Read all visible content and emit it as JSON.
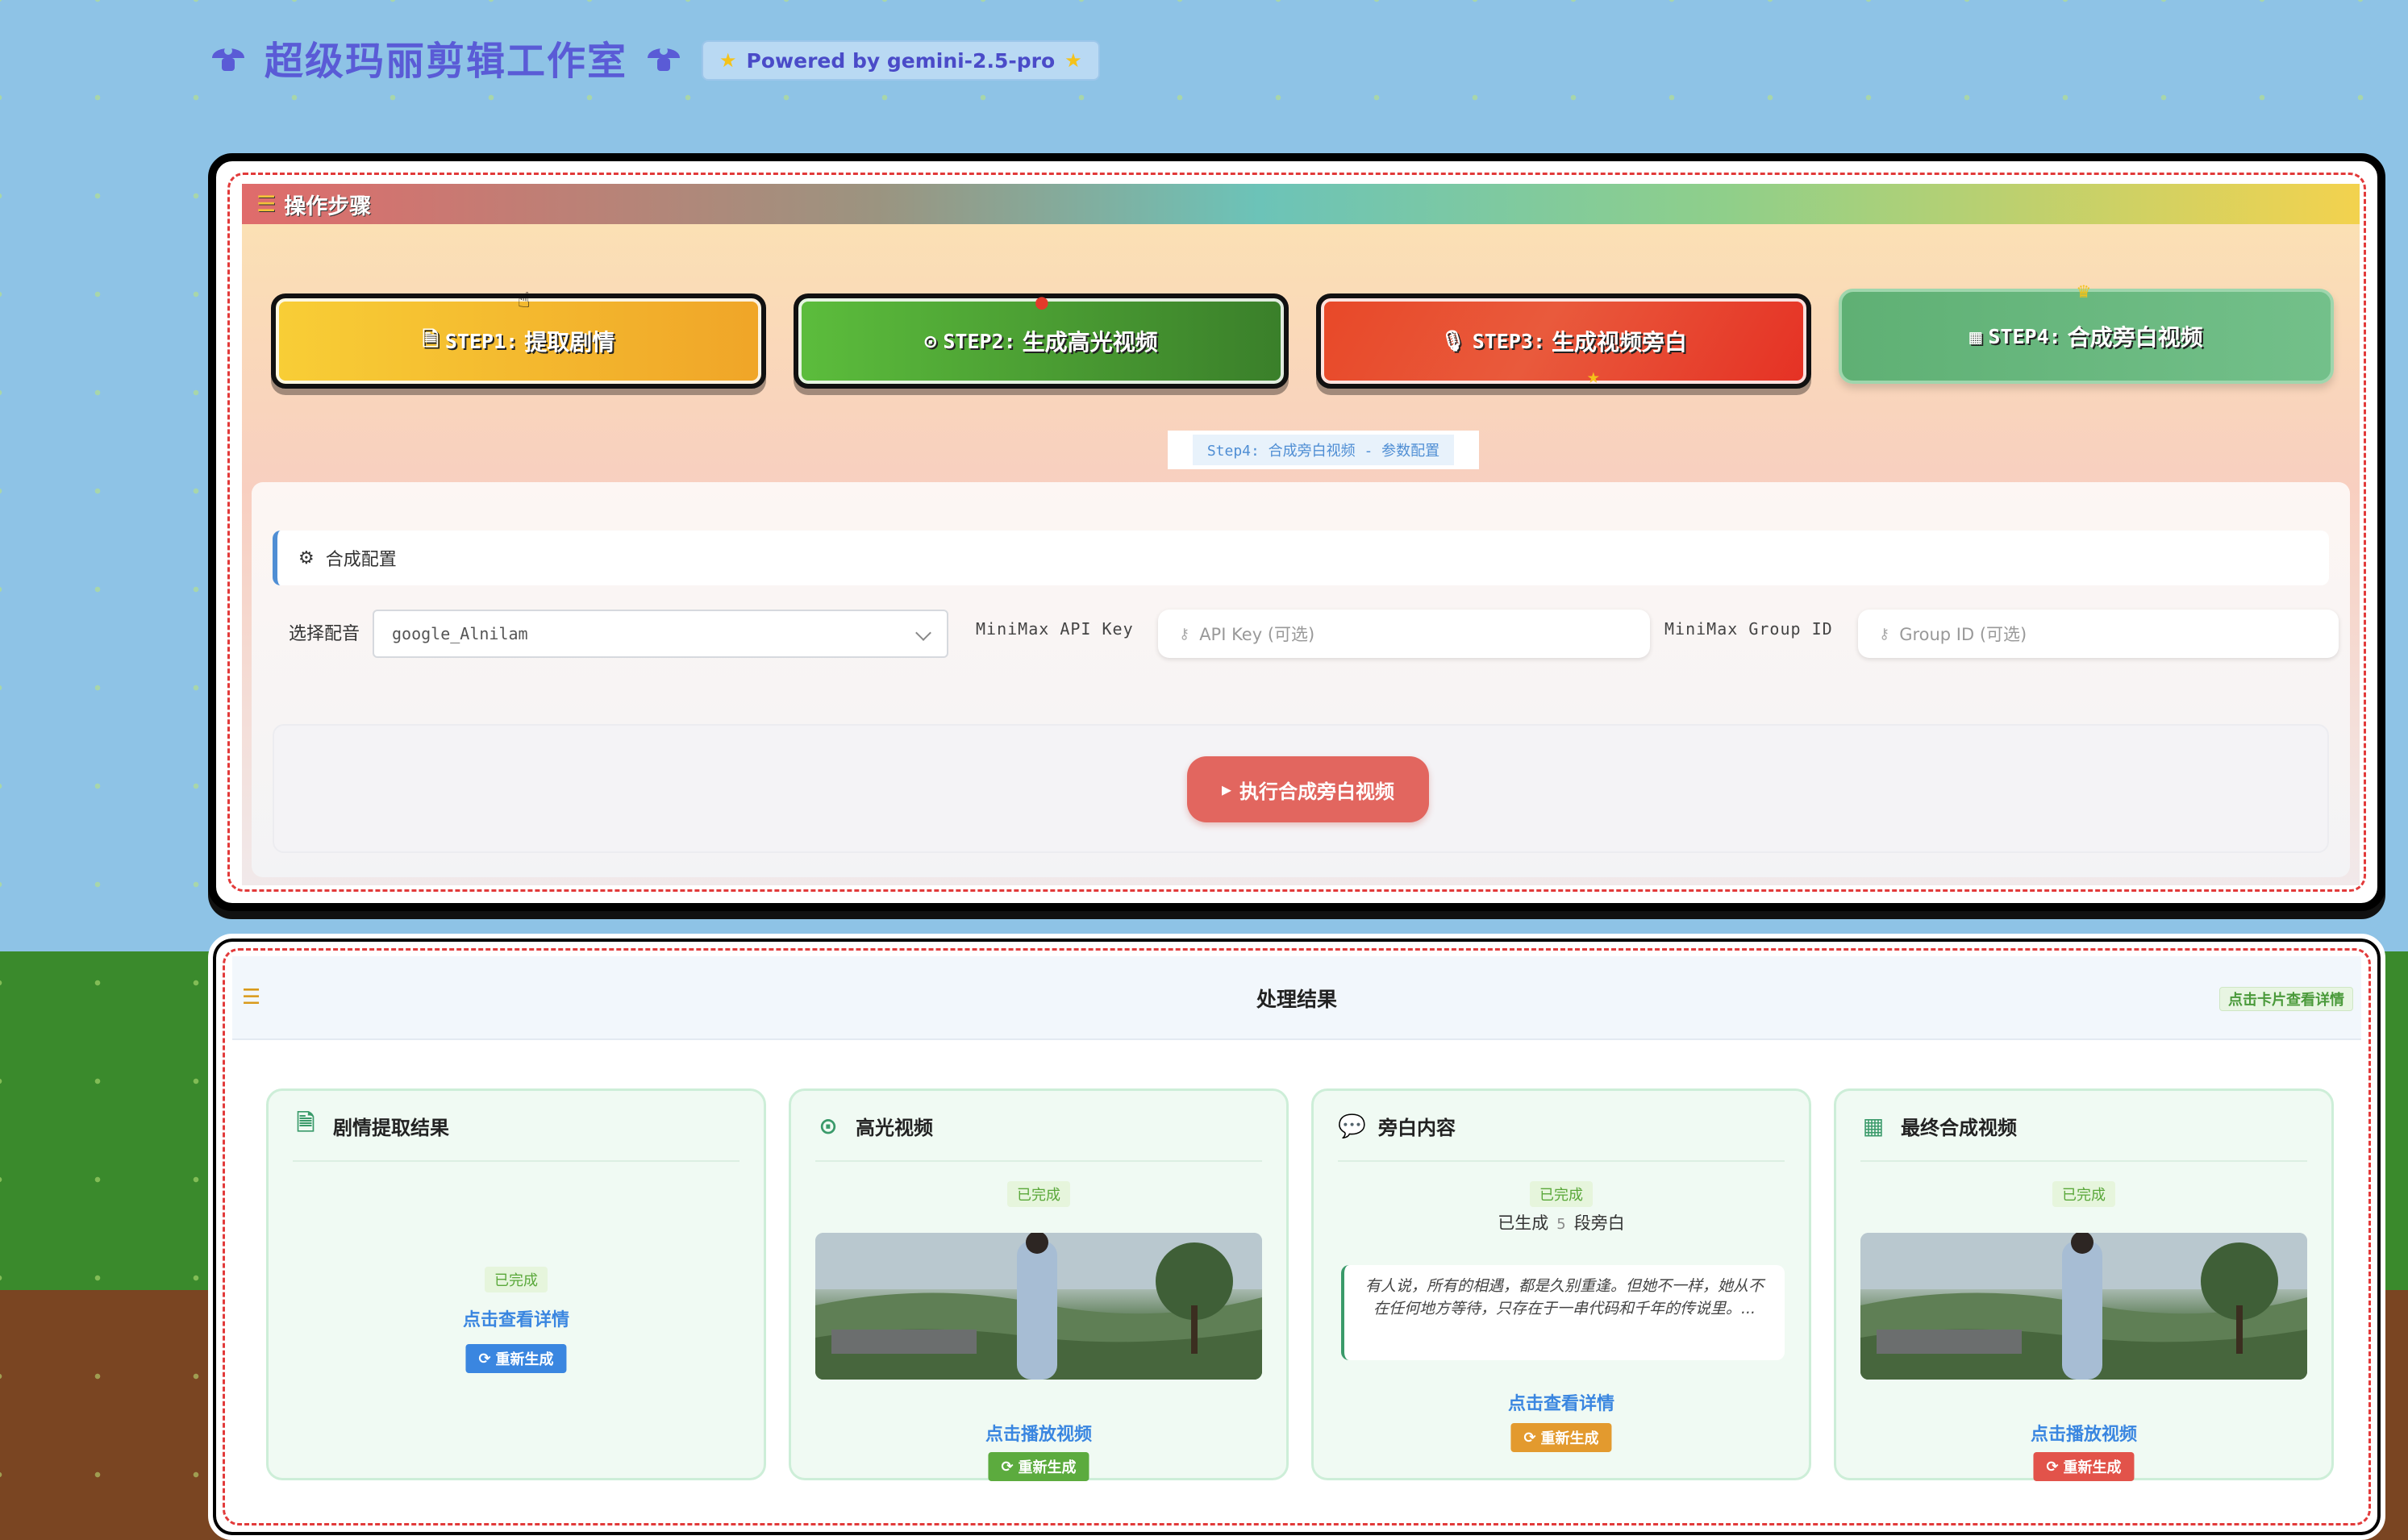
{
  "header": {
    "title": "超级玛丽剪辑工作室",
    "powered_by": "Powered by gemini-2.5-pro",
    "left_icon": "mushroom-icon",
    "right_icon": "mushroom-icon"
  },
  "steps_panel": {
    "title": "操作步骤",
    "steps": [
      {
        "code": "STEP1:",
        "label": "提取剧情",
        "icon": "document-icon",
        "color": "#f4b82e"
      },
      {
        "code": "STEP2:",
        "label": "生成高光视频",
        "icon": "play-circle-icon",
        "color": "#4d9f33"
      },
      {
        "code": "STEP3:",
        "label": "生成视频旁白",
        "icon": "microphone-icon",
        "color": "#e6432a"
      },
      {
        "code": "STEP4:",
        "label": "合成旁白视频",
        "icon": "table-icon",
        "color": "#66b57c"
      }
    ],
    "active_step_tag": "Step4: 合成旁白视频 - 参数配置"
  },
  "config": {
    "section_title": "合成配置",
    "voice_label": "选择配音",
    "voice_value": "google_Alnilam",
    "api_key_label": "MiniMax API Key",
    "api_key_placeholder": "API Key (可选)",
    "group_id_label": "MiniMax Group ID",
    "group_id_placeholder": "Group ID (可选)",
    "execute_button": "执行合成旁白视频"
  },
  "results": {
    "title": "处理结果",
    "hint": "点击卡片查看详情",
    "cards": [
      {
        "title": "剧情提取结果",
        "status": "已完成",
        "link": "点击查看详情",
        "regen": "重新生成",
        "regen_color": "#3a86e0"
      },
      {
        "title": "高光视频",
        "status": "已完成",
        "link": "点击播放视频",
        "regen": "重新生成",
        "regen_color": "#5cab3e"
      },
      {
        "title": "旁白内容",
        "status": "已完成",
        "count_prefix": "已生成",
        "count": "5",
        "count_suffix": "段旁白",
        "quote": "有人说，所有的相遇，都是久别重逢。但她不一样，她从不在任何地方等待，只存在于一串代码和千年的传说里。...",
        "link": "点击查看详情",
        "regen": "重新生成",
        "regen_color": "#e39a2e"
      },
      {
        "title": "最终合成视频",
        "status": "已完成",
        "link": "点击播放视频",
        "regen": "重新生成",
        "regen_color": "#e2534a"
      }
    ]
  }
}
